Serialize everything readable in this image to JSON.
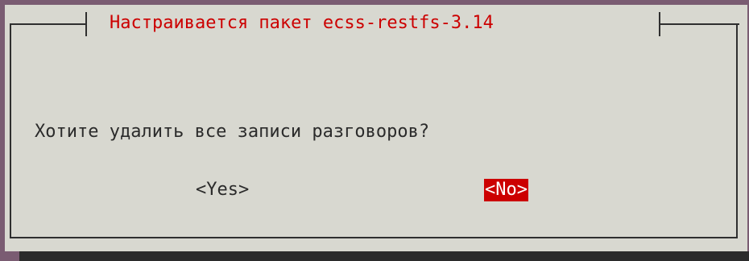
{
  "dialog": {
    "title": "Настраивается пакет ecss-restfs-3.14",
    "question": "Хотите удалить все записи разговоров?",
    "buttons": {
      "yes_label": "<Yes>",
      "no_label": "<No>"
    },
    "selected_button": "no"
  },
  "colors": {
    "background": "#d8d8d0",
    "accent": "#cc0000",
    "text": "#2b2b2b",
    "desktop": "#7a5c72"
  }
}
